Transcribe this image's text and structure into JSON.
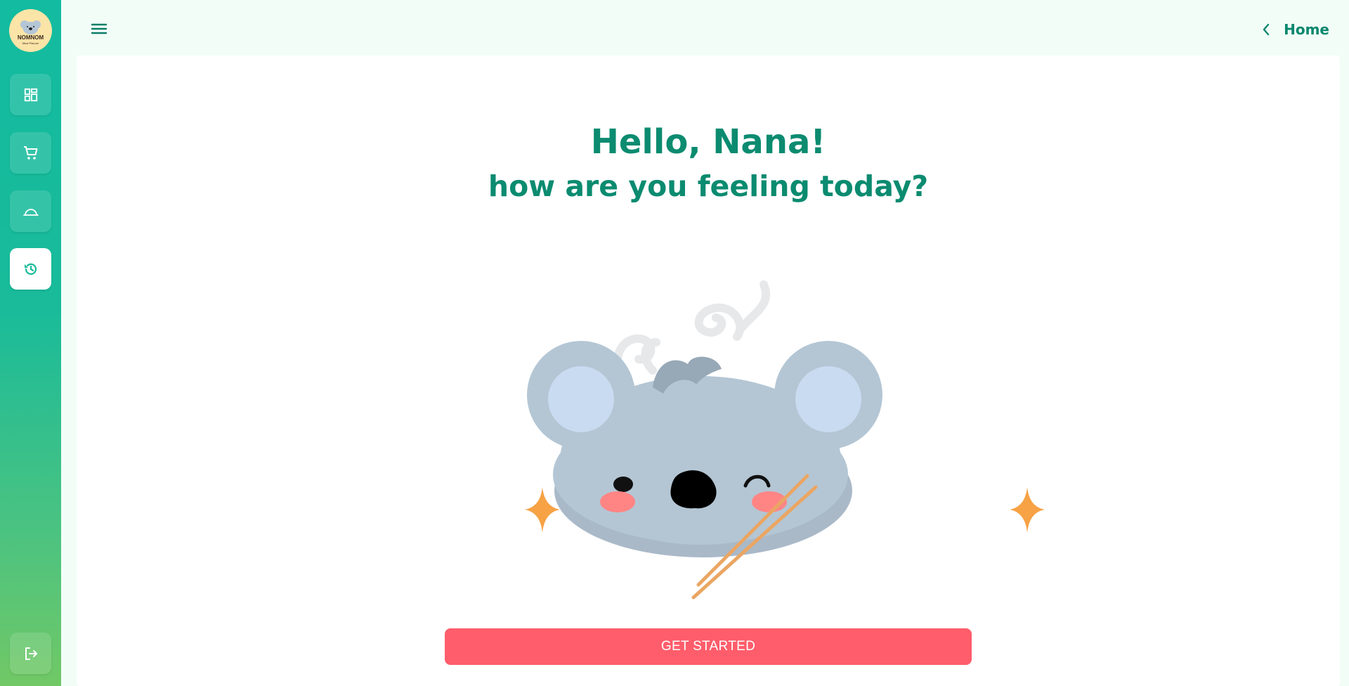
{
  "app": {
    "logo_text": "NOMNOM",
    "logo_subtext": "Meal Planner"
  },
  "sidebar": {
    "items": [
      {
        "icon": "dashboard-icon",
        "active": false
      },
      {
        "icon": "cart-icon",
        "active": false
      },
      {
        "icon": "food-cloche-icon",
        "active": false
      },
      {
        "icon": "history-icon",
        "active": true
      }
    ],
    "logout_icon": "logout-icon"
  },
  "topbar": {
    "menu_icon": "hamburger-menu-icon",
    "back_label": "Home",
    "back_icon": "chevron-left-icon"
  },
  "main": {
    "greeting": "Hello, Nana!",
    "subtitle": "how are you feeling today?",
    "cta_label": "GET STARTED"
  },
  "colors": {
    "accent": "#0b8b70",
    "cta": "#ff5d6b",
    "sidebar_top": "#13bba0",
    "sidebar_bottom": "#71c865",
    "sparkle": "#f6a245"
  }
}
